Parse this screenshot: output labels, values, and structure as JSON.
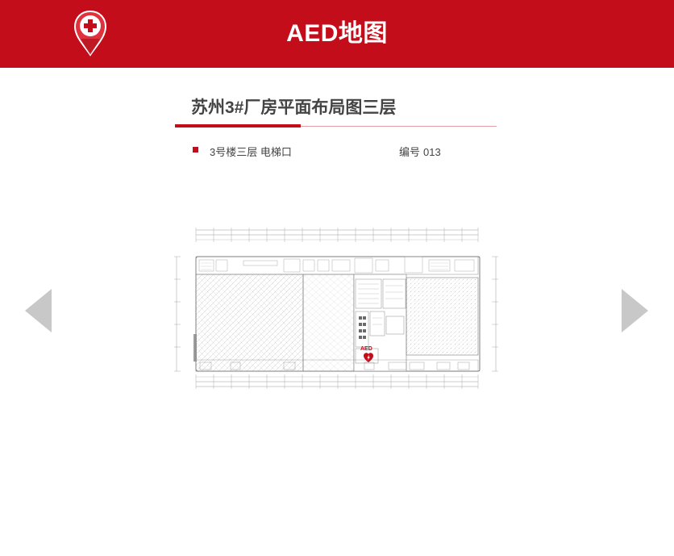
{
  "header": {
    "title": "AED地图",
    "brand_color": "#c30d1b",
    "logo_icon": "map-pin-medical-cross-icon"
  },
  "page": {
    "title": "苏州3#厂房平面布局图三层",
    "location": "3号楼三层 电梯口",
    "serial_label": "编号",
    "serial_value": "013"
  },
  "map": {
    "marker_label": "AED",
    "marker_icon": "aed-heart-icon"
  },
  "nav": {
    "prev_icon": "chevron-left-icon",
    "next_icon": "chevron-right-icon",
    "arrow_color": "#c8c8c8"
  }
}
